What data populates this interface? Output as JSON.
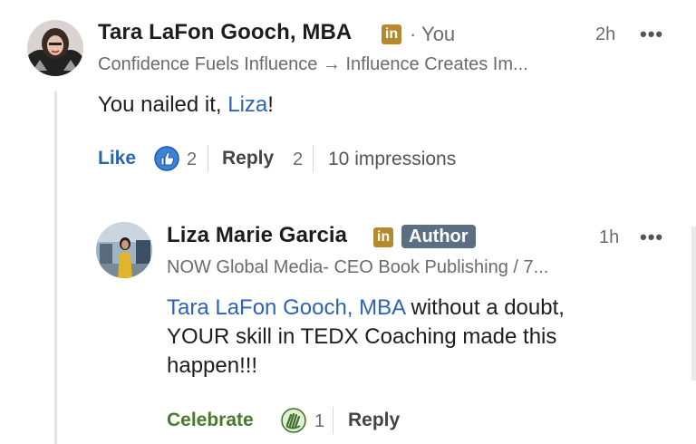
{
  "comment": {
    "author": "Tara LaFon Gooch, MBA",
    "badge": "in",
    "you_label": "· You",
    "headline": "Confidence Fuels Influence → Influence Creates Im...",
    "time": "2h",
    "more": "•••",
    "text_prefix": "You nailed it, ",
    "mention": "Liza",
    "text_suffix": "!",
    "like_label": "Like",
    "like_count": "2",
    "reply_label": "Reply",
    "reply_count": "2",
    "impressions": "10 impressions"
  },
  "reply": {
    "author": "Liza Marie Garcia",
    "badge": "in",
    "author_tag": "Author",
    "headline": "NOW Global Media- CEO Book Publishing / 7...",
    "time": "1h",
    "more": "•••",
    "mention": "Tara LaFon Gooch, MBA",
    "text_line1_rest": " without a doubt,",
    "text_line2": "YOUR skill in TEDX Coaching made this",
    "text_line3": "happen!!!",
    "celebrate_label": "Celebrate",
    "celebrate_count": "1",
    "reply_label": "Reply"
  },
  "colors": {
    "link": "#2b63b5",
    "celebrate": "#4a7a2e",
    "badge": "#b68a2c",
    "author_tag": "#5b6f82"
  },
  "icons": {
    "like": "thumbs-up-icon",
    "celebrate": "clapping-hands-icon",
    "more": "more-options-icon"
  }
}
